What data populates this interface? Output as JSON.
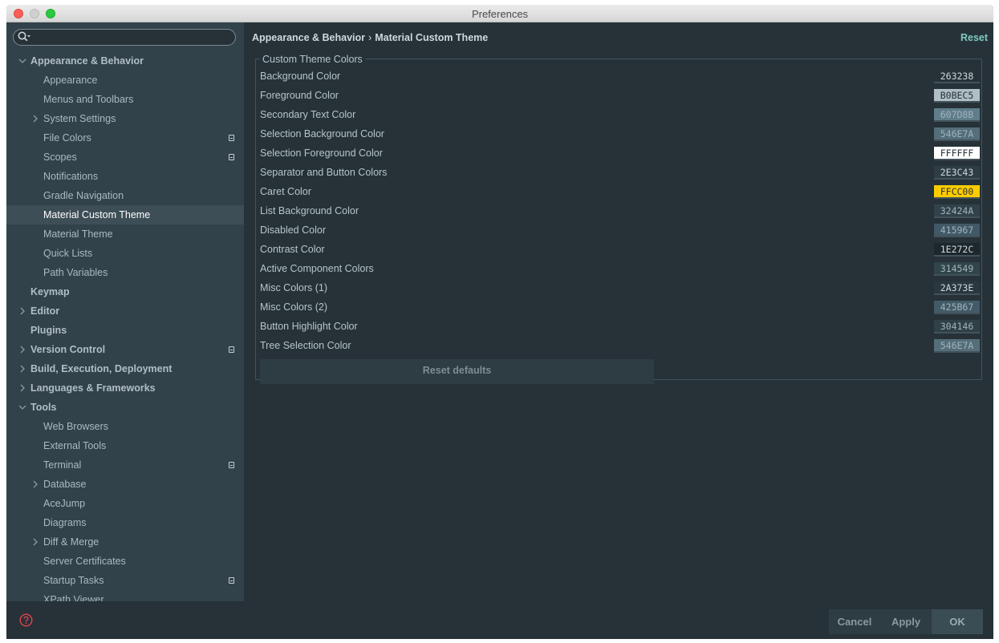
{
  "window": {
    "title": "Preferences"
  },
  "search": {
    "placeholder": ""
  },
  "sidebar": {
    "items": [
      {
        "label": "Appearance & Behavior",
        "level": 0,
        "chevron": "down",
        "badge": false,
        "selected": false
      },
      {
        "label": "Appearance",
        "level": 1,
        "chevron": "",
        "badge": false,
        "selected": false
      },
      {
        "label": "Menus and Toolbars",
        "level": 1,
        "chevron": "",
        "badge": false,
        "selected": false
      },
      {
        "label": "System Settings",
        "level": 1,
        "chevron": "right",
        "badge": false,
        "selected": false
      },
      {
        "label": "File Colors",
        "level": 1,
        "chevron": "",
        "badge": true,
        "selected": false
      },
      {
        "label": "Scopes",
        "level": 1,
        "chevron": "",
        "badge": true,
        "selected": false
      },
      {
        "label": "Notifications",
        "level": 1,
        "chevron": "",
        "badge": false,
        "selected": false
      },
      {
        "label": "Gradle Navigation",
        "level": 1,
        "chevron": "",
        "badge": false,
        "selected": false
      },
      {
        "label": "Material Custom Theme",
        "level": 1,
        "chevron": "",
        "badge": false,
        "selected": true
      },
      {
        "label": "Material Theme",
        "level": 1,
        "chevron": "",
        "badge": false,
        "selected": false
      },
      {
        "label": "Quick Lists",
        "level": 1,
        "chevron": "",
        "badge": false,
        "selected": false
      },
      {
        "label": "Path Variables",
        "level": 1,
        "chevron": "",
        "badge": false,
        "selected": false
      },
      {
        "label": "Keymap",
        "level": 0,
        "chevron": "",
        "badge": false,
        "selected": false
      },
      {
        "label": "Editor",
        "level": 0,
        "chevron": "right",
        "badge": false,
        "selected": false
      },
      {
        "label": "Plugins",
        "level": 0,
        "chevron": "",
        "badge": false,
        "selected": false
      },
      {
        "label": "Version Control",
        "level": 0,
        "chevron": "right",
        "badge": true,
        "selected": false
      },
      {
        "label": "Build, Execution, Deployment",
        "level": 0,
        "chevron": "right",
        "badge": false,
        "selected": false
      },
      {
        "label": "Languages & Frameworks",
        "level": 0,
        "chevron": "right",
        "badge": false,
        "selected": false
      },
      {
        "label": "Tools",
        "level": 0,
        "chevron": "down",
        "badge": false,
        "selected": false
      },
      {
        "label": "Web Browsers",
        "level": 1,
        "chevron": "",
        "badge": false,
        "selected": false
      },
      {
        "label": "External Tools",
        "level": 1,
        "chevron": "",
        "badge": false,
        "selected": false
      },
      {
        "label": "Terminal",
        "level": 1,
        "chevron": "",
        "badge": true,
        "selected": false
      },
      {
        "label": "Database",
        "level": 1,
        "chevron": "right",
        "badge": false,
        "selected": false
      },
      {
        "label": "AceJump",
        "level": 1,
        "chevron": "",
        "badge": false,
        "selected": false
      },
      {
        "label": "Diagrams",
        "level": 1,
        "chevron": "",
        "badge": false,
        "selected": false
      },
      {
        "label": "Diff & Merge",
        "level": 1,
        "chevron": "right",
        "badge": false,
        "selected": false
      },
      {
        "label": "Server Certificates",
        "level": 1,
        "chevron": "",
        "badge": false,
        "selected": false
      },
      {
        "label": "Startup Tasks",
        "level": 1,
        "chevron": "",
        "badge": true,
        "selected": false
      },
      {
        "label": "XPath Viewer",
        "level": 1,
        "chevron": "",
        "badge": false,
        "selected": false
      }
    ]
  },
  "breadcrumb": {
    "parent": "Appearance & Behavior",
    "separator": "›",
    "current": "Material Custom Theme"
  },
  "header": {
    "reset_label": "Reset"
  },
  "group": {
    "title": "Custom Theme Colors",
    "colors": [
      {
        "label": "Background Color",
        "value": "263238"
      },
      {
        "label": "Foreground Color",
        "value": "B0BEC5"
      },
      {
        "label": "Secondary Text Color",
        "value": "607D8B"
      },
      {
        "label": "Selection Background Color",
        "value": "546E7A"
      },
      {
        "label": "Selection Foreground Color",
        "value": "FFFFFF"
      },
      {
        "label": "Separator and Button Colors",
        "value": "2E3C43"
      },
      {
        "label": "Caret Color",
        "value": "FFCC00"
      },
      {
        "label": "List Background Color",
        "value": "32424A"
      },
      {
        "label": "Disabled Color",
        "value": "415967"
      },
      {
        "label": "Contrast Color",
        "value": "1E272C"
      },
      {
        "label": "Active Component Colors",
        "value": "314549"
      },
      {
        "label": "Misc Colors (1)",
        "value": "2A373E"
      },
      {
        "label": "Misc Colors (2)",
        "value": "425B67"
      },
      {
        "label": "Button Highlight Color",
        "value": "304146"
      },
      {
        "label": "Tree Selection Color",
        "value": "546E7A"
      }
    ],
    "reset_defaults_label": "Reset defaults"
  },
  "footer": {
    "cancel_label": "Cancel",
    "apply_label": "Apply",
    "ok_label": "OK"
  },
  "theme": {
    "accent": "#7FC9C0",
    "window_bg": "#263238",
    "sidebar_bg": "#32424A",
    "selection_bg": "#3D4E56",
    "help_icon_color": "#E5424D"
  }
}
